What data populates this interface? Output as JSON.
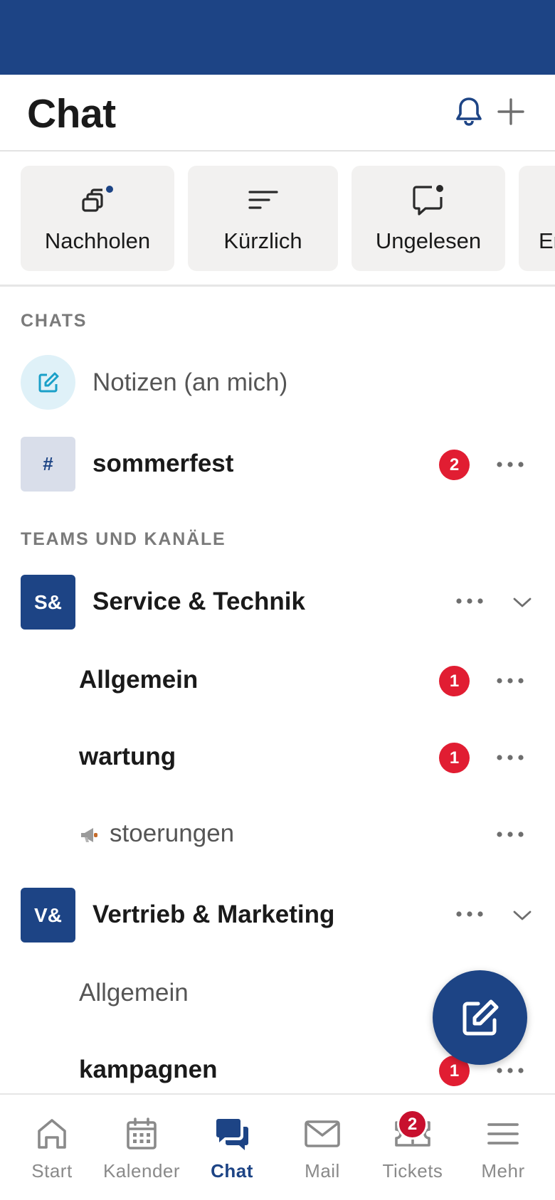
{
  "header": {
    "title": "Chat"
  },
  "filters": [
    {
      "label": "Nachholen",
      "icon": "catch-up-icon"
    },
    {
      "label": "Kürzlich",
      "icon": "sort-icon"
    },
    {
      "label": "Ungelesen",
      "icon": "unread-icon"
    },
    {
      "label": "Er",
      "icon": ""
    }
  ],
  "sections": {
    "chats": "CHATS",
    "teams": "TEAMS UND KANÄLE"
  },
  "chats": [
    {
      "name": "Notizen (an mich)",
      "icon": "edit-icon"
    },
    {
      "name": "sommerfest",
      "avatar_text": "#",
      "badge": "2"
    }
  ],
  "teams": [
    {
      "initials": "S&",
      "name": "Service & Technik",
      "channels": [
        {
          "name": "Allgemein",
          "badge": "1"
        },
        {
          "name": "wartung",
          "badge": "1"
        },
        {
          "name": "stoerungen",
          "icon": "megaphone-icon"
        }
      ]
    },
    {
      "initials": "V&",
      "name": "Vertrieb & Marketing",
      "channels": [
        {
          "name": "Allgemein"
        },
        {
          "name": "kampagnen",
          "badge": "1"
        }
      ]
    }
  ],
  "nav": [
    {
      "label": "Start",
      "icon": "home-icon"
    },
    {
      "label": "Kalender",
      "icon": "calendar-icon"
    },
    {
      "label": "Chat",
      "icon": "chat-icon",
      "active": true
    },
    {
      "label": "Mail",
      "icon": "mail-icon"
    },
    {
      "label": "Tickets",
      "icon": "ticket-icon",
      "badge": "2"
    },
    {
      "label": "Mehr",
      "icon": "menu-icon"
    }
  ],
  "colors": {
    "brand": "#1d4485",
    "badge": "#e11d32",
    "chip_bg": "#f2f1f0"
  }
}
